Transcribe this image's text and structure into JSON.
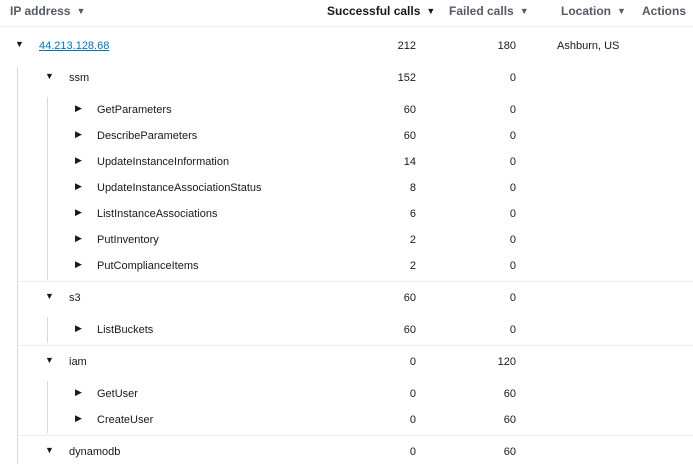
{
  "header": {
    "ip_label": "IP address",
    "success_label": "Successful calls",
    "failed_label": "Failed calls",
    "location_label": "Location",
    "actions_label": "Actions"
  },
  "root": {
    "ip": "44.213.128.68",
    "successful": "212",
    "failed": "180",
    "location": "Ashburn, US"
  },
  "groups": [
    {
      "name": "ssm",
      "successful": "152",
      "failed": "0",
      "items": [
        {
          "name": "GetParameters",
          "successful": "60",
          "failed": "0"
        },
        {
          "name": "DescribeParameters",
          "successful": "60",
          "failed": "0"
        },
        {
          "name": "UpdateInstanceInformation",
          "successful": "14",
          "failed": "0"
        },
        {
          "name": "UpdateInstanceAssociationStatus",
          "successful": "8",
          "failed": "0"
        },
        {
          "name": "ListInstanceAssociations",
          "successful": "6",
          "failed": "0"
        },
        {
          "name": "PutInventory",
          "successful": "2",
          "failed": "0"
        },
        {
          "name": "PutComplianceItems",
          "successful": "2",
          "failed": "0"
        }
      ]
    },
    {
      "name": "s3",
      "successful": "60",
      "failed": "0",
      "items": [
        {
          "name": "ListBuckets",
          "successful": "60",
          "failed": "0"
        }
      ]
    },
    {
      "name": "iam",
      "successful": "0",
      "failed": "120",
      "items": [
        {
          "name": "GetUser",
          "successful": "0",
          "failed": "60"
        },
        {
          "name": "CreateUser",
          "successful": "0",
          "failed": "60"
        }
      ]
    },
    {
      "name": "dynamodb",
      "successful": "0",
      "failed": "60",
      "items": []
    }
  ]
}
